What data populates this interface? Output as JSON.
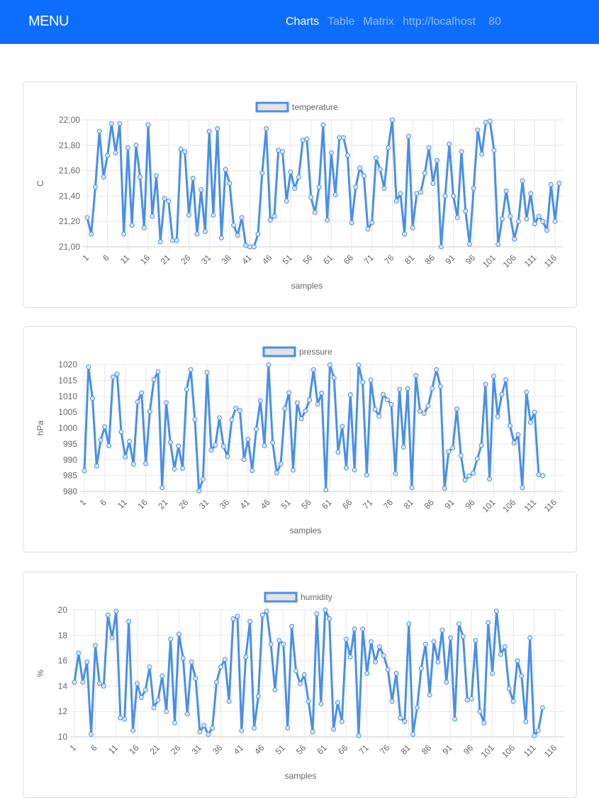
{
  "navbar": {
    "brand": "MENU",
    "links": [
      {
        "label": "Charts",
        "active": true
      },
      {
        "label": "Table",
        "active": false
      },
      {
        "label": "Matrix",
        "active": false
      },
      {
        "label": "http://localhost",
        "active": false
      },
      {
        "label": "80",
        "active": false
      }
    ]
  },
  "colors": {
    "navbar_bg": "#0d6efd",
    "line": "#4a8fe8",
    "legend_fill": "#e3e3e3"
  },
  "chart_data": [
    {
      "type": "line",
      "title": "",
      "legend": "temperature",
      "legend_position": "top",
      "xlabel": "samples",
      "ylabel": "C",
      "ylim": [
        21.0,
        22.0
      ],
      "yticks": [
        "21,00",
        "21,20",
        "21,40",
        "21,60",
        "21,80",
        "22,00"
      ],
      "ytick_values": [
        21.0,
        21.2,
        21.4,
        21.6,
        21.8,
        22.0
      ],
      "xticks": [
        1,
        6,
        11,
        16,
        21,
        26,
        31,
        36,
        41,
        46,
        51,
        56,
        61,
        66,
        71,
        76,
        81,
        86,
        91,
        96,
        101,
        106,
        111,
        116
      ],
      "grid": true,
      "values": [
        21.23,
        21.1,
        21.47,
        21.91,
        21.55,
        21.72,
        21.97,
        21.74,
        21.97,
        21.1,
        21.78,
        21.17,
        21.8,
        21.55,
        21.15,
        21.96,
        21.24,
        21.56,
        21.04,
        21.38,
        21.36,
        21.05,
        21.05,
        21.77,
        21.75,
        21.25,
        21.54,
        21.1,
        21.45,
        21.12,
        21.91,
        21.25,
        21.93,
        21.07,
        21.61,
        21.5,
        21.17,
        21.09,
        21.23,
        21.01,
        21.0,
        21.0,
        21.1,
        21.58,
        21.93,
        21.21,
        21.24,
        21.76,
        21.75,
        21.36,
        21.59,
        21.46,
        21.55,
        21.84,
        21.85,
        21.39,
        21.27,
        21.47,
        21.96,
        21.21,
        21.74,
        21.41,
        21.86,
        21.86,
        21.72,
        21.19,
        21.47,
        21.62,
        21.56,
        21.14,
        21.19,
        21.7,
        21.61,
        21.46,
        21.78,
        22.0,
        21.36,
        21.42,
        21.1,
        21.87,
        21.15,
        21.42,
        21.43,
        21.58,
        21.78,
        21.5,
        21.68,
        21.0,
        21.4,
        21.81,
        21.4,
        21.23,
        21.75,
        21.28,
        21.02,
        21.46,
        21.92,
        21.73,
        21.98,
        21.99,
        21.76,
        21.02,
        21.22,
        21.44,
        21.24,
        21.06,
        21.2,
        21.52,
        21.22,
        21.42,
        21.18,
        21.24,
        21.2,
        21.13,
        21.49,
        21.2,
        21.5
      ]
    },
    {
      "type": "line",
      "title": "",
      "legend": "pressure",
      "legend_position": "top",
      "xlabel": "samples",
      "ylabel": "hPa",
      "ylim": [
        980,
        1020
      ],
      "yticks": [
        "980",
        "985",
        "990",
        "995",
        "1000",
        "1005",
        "1010",
        "1015",
        "1020"
      ],
      "ytick_values": [
        980,
        985,
        990,
        995,
        1000,
        1005,
        1010,
        1015,
        1020
      ],
      "xticks": [
        1,
        6,
        11,
        16,
        21,
        26,
        31,
        36,
        41,
        46,
        51,
        56,
        61,
        66,
        71,
        76,
        81,
        86,
        91,
        96,
        101,
        106,
        111,
        116
      ],
      "grid": true,
      "values": [
        986.5,
        1019.2,
        1009.3,
        988.0,
        996.2,
        1000.4,
        994.4,
        1016.1,
        1017.0,
        998.8,
        990.9,
        995.8,
        988.6,
        1008.2,
        1011.1,
        988.8,
        1005.2,
        1015.3,
        1017.7,
        981.2,
        1008.0,
        995.5,
        987.1,
        994.3,
        987.3,
        1012.2,
        1018.4,
        1002.7,
        980.2,
        983.9,
        1017.5,
        993.0,
        994.6,
        1003.2,
        994.2,
        991.0,
        1002.6,
        1006.2,
        1005.5,
        990.1,
        996.5,
        986.6,
        999.6,
        1008.6,
        994.4,
        1019.9,
        995.4,
        985.9,
        988.7,
        1006.1,
        1011.1,
        986.7,
        1007.9,
        1002.9,
        1005.4,
        1008.8,
        1018.4,
        1007.5,
        1011.0,
        980.5,
        1019.9,
        1015.8,
        992.4,
        1000.5,
        987.4,
        1010.5,
        986.8,
        1019.8,
        1014.4,
        985.2,
        1015.1,
        1005.9,
        1003.7,
        1010.6,
        1008.9,
        1007.4,
        985.6,
        1012.2,
        994.0,
        1012.4,
        981.2,
        1016.5,
        1005.3,
        1004.6,
        1007.0,
        1012.5,
        1018.4,
        1013.1,
        981.0,
        992.6,
        993.7,
        1006.0,
        991.3,
        983.6,
        984.9,
        985.8,
        990.3,
        994.5,
        1013.8,
        983.9,
        1016.3,
        1003.6,
        1010.6,
        1015.2,
        1000.7,
        995.3,
        997.9,
        981.2,
        1011.3,
        1001.8,
        1005.0,
        985.3,
        985.0
      ]
    },
    {
      "type": "line",
      "title": "",
      "legend": "humidity",
      "legend_position": "top",
      "xlabel": "samples",
      "ylabel": "%",
      "ylim": [
        10,
        20
      ],
      "yticks": [
        "10",
        "12",
        "14",
        "16",
        "18",
        "20"
      ],
      "ytick_values": [
        10,
        12,
        14,
        16,
        18,
        20
      ],
      "xticks": [
        1,
        6,
        11,
        16,
        21,
        26,
        31,
        36,
        41,
        46,
        51,
        56,
        61,
        66,
        71,
        76,
        81,
        86,
        91,
        96,
        101,
        106,
        111,
        116
      ],
      "grid": true,
      "values": [
        14.3,
        16.6,
        14.3,
        15.9,
        10.2,
        17.2,
        14.2,
        14.0,
        19.6,
        17.8,
        19.9,
        11.5,
        11.4,
        19.1,
        10.5,
        14.2,
        13.1,
        13.7,
        15.5,
        12.3,
        12.9,
        14.8,
        12.0,
        17.7,
        11.1,
        18.1,
        16.2,
        11.8,
        15.9,
        14.6,
        10.4,
        10.9,
        10.2,
        10.7,
        14.3,
        15.5,
        16.1,
        12.8,
        19.3,
        19.5,
        10.5,
        16.3,
        19.1,
        10.7,
        13.2,
        19.6,
        19.9,
        17.3,
        13.7,
        17.6,
        17.3,
        10.7,
        18.7,
        15.2,
        14.2,
        14.9,
        12.8,
        10.4,
        19.7,
        12.6,
        20.0,
        19.3,
        10.6,
        12.7,
        11.2,
        17.7,
        16.3,
        18.5,
        10.1,
        18.5,
        15.0,
        17.5,
        15.9,
        17.1,
        16.4,
        15.3,
        12.8,
        15.0,
        11.5,
        11.2,
        18.9,
        10.2,
        12.3,
        15.4,
        17.3,
        13.3,
        17.5,
        15.9,
        18.4,
        14.3,
        17.8,
        11.4,
        18.9,
        17.9,
        12.9,
        13.0,
        17.6,
        12.0,
        11.1,
        19.0,
        15.0,
        19.9,
        16.5,
        17.1,
        13.8,
        12.8,
        16.0,
        14.8,
        11.2,
        17.8,
        10.1,
        10.5,
        12.3
      ]
    }
  ]
}
